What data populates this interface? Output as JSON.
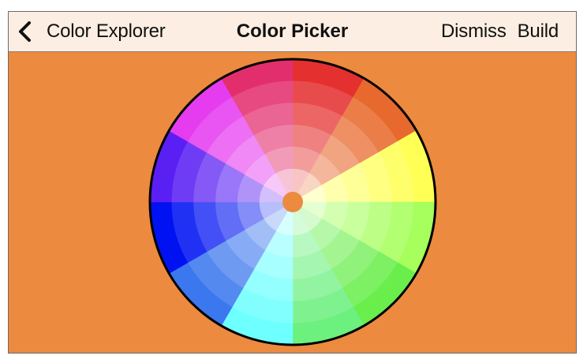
{
  "navbar": {
    "back_label": "Color Explorer",
    "title": "Color Picker",
    "dismiss_label": "Dismiss",
    "build_label": "Build"
  },
  "icons": {
    "back": "chevron-left-icon"
  },
  "colors": {
    "background": "#EC8A3F",
    "navbar_background": "#FCEEE2",
    "text": "#111111",
    "wheel_outline": "#000000",
    "center_dot": "#EC8A3F"
  },
  "color_wheel": {
    "ring_count": 5,
    "segments": [
      "#E53030",
      "#E8692E",
      "#FFFF55",
      "#A6FF5C",
      "#69EE4C",
      "#6CF07E",
      "#6EFFFF",
      "#3B77EE",
      "#0012F2",
      "#5A1FF3",
      "#E63CF0",
      "#E32E6E"
    ]
  }
}
